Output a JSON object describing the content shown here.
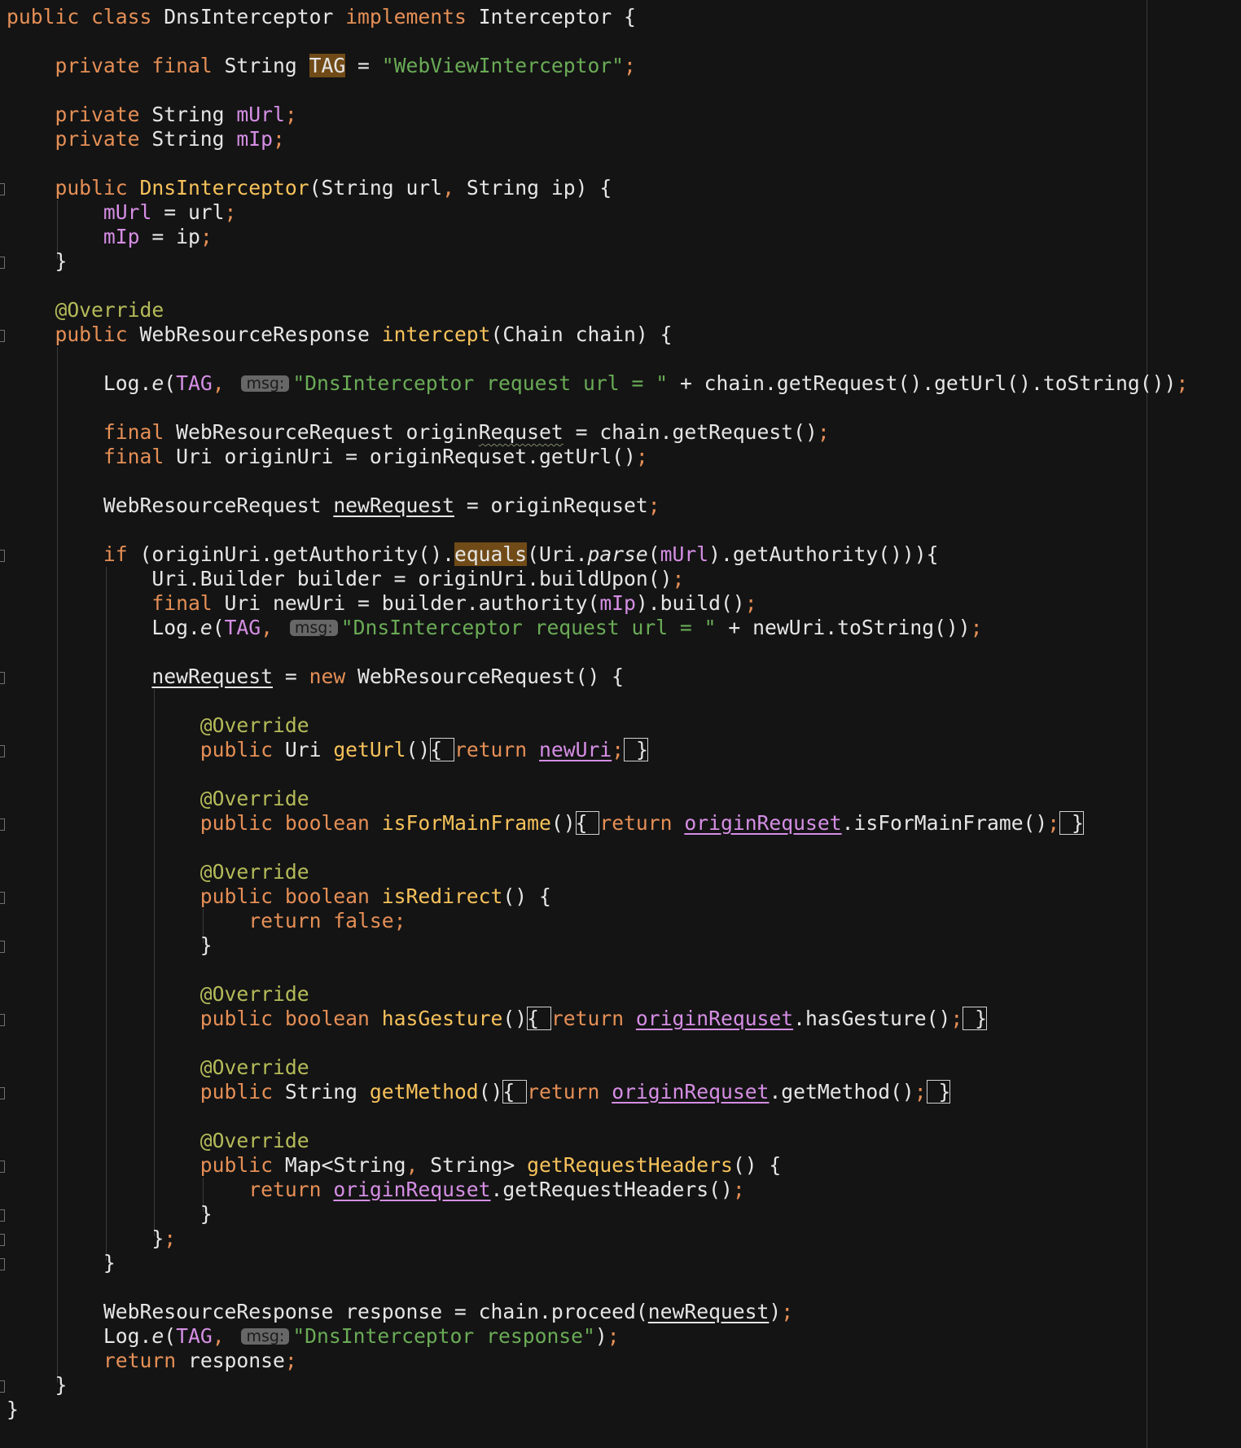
{
  "editor": {
    "language": "java",
    "theme": "dark",
    "colors": {
      "background": "#141414",
      "keyword": "#e58f56",
      "string": "#6aab56",
      "field": "#d58ee4",
      "method": "#f7c25b",
      "annotation": "#b5bb59",
      "plain": "#e6e6e6",
      "hint_background": "#676767",
      "search_highlight": "#704b17"
    },
    "lines": [
      [
        [
          "keyword",
          "public class "
        ],
        [
          "plain",
          "DnsInterceptor "
        ],
        [
          "keyword",
          "implements "
        ],
        [
          "plain",
          "Interceptor {"
        ]
      ],
      [],
      [
        [
          "keyword",
          "    private final "
        ],
        [
          "plain",
          "String "
        ],
        [
          "plain-hl",
          "TAG"
        ],
        [
          "plain",
          " = "
        ],
        [
          "string",
          "\"WebViewInterceptor\""
        ],
        [
          "punct",
          ";"
        ]
      ],
      [],
      [
        [
          "keyword",
          "    private "
        ],
        [
          "plain",
          "String "
        ],
        [
          "field",
          "mUrl"
        ],
        [
          "punct",
          ";"
        ]
      ],
      [
        [
          "keyword",
          "    private "
        ],
        [
          "plain",
          "String "
        ],
        [
          "field",
          "mIp"
        ],
        [
          "punct",
          ";"
        ]
      ],
      [],
      [
        [
          "keyword",
          "    public "
        ],
        [
          "method",
          "DnsInterceptor"
        ],
        [
          "plain",
          "(String url"
        ],
        [
          "punct",
          ", "
        ],
        [
          "plain",
          "String ip) {"
        ]
      ],
      [
        [
          "field",
          "        mUrl"
        ],
        [
          "plain",
          " = url"
        ],
        [
          "punct",
          ";"
        ]
      ],
      [
        [
          "field",
          "        mIp"
        ],
        [
          "plain",
          " = ip"
        ],
        [
          "punct",
          ";"
        ]
      ],
      [
        [
          "plain",
          "    }"
        ]
      ],
      [],
      [
        [
          "annotation",
          "    @Override"
        ]
      ],
      [
        [
          "keyword",
          "    public "
        ],
        [
          "plain",
          "WebResourceResponse "
        ],
        [
          "method",
          "intercept"
        ],
        [
          "plain",
          "(Chain chain) {"
        ]
      ],
      [],
      [
        [
          "plain",
          "        Log."
        ],
        [
          "static",
          "e"
        ],
        [
          "plain",
          "("
        ],
        [
          "field",
          "TAG"
        ],
        [
          "punct",
          ", "
        ],
        [
          "hint",
          "msg:"
        ],
        [
          "string",
          "\"DnsInterceptor request url = \""
        ],
        [
          "plain",
          " + chain.getRequest().getUrl().toString())"
        ],
        [
          "punct",
          ";"
        ]
      ],
      [],
      [
        [
          "keyword",
          "        final "
        ],
        [
          "plain",
          "WebResourceRequest origin"
        ],
        [
          "squiggle",
          "Requset"
        ],
        [
          "plain",
          " = chain.getRequest()"
        ],
        [
          "punct",
          ";"
        ]
      ],
      [
        [
          "keyword",
          "        final "
        ],
        [
          "plain",
          "Uri originUri = originRequset.getUrl()"
        ],
        [
          "punct",
          ";"
        ]
      ],
      [],
      [
        [
          "plain",
          "        WebResourceRequest "
        ],
        [
          "underlined",
          "newRequest"
        ],
        [
          "plain",
          " = originRequset"
        ],
        [
          "punct",
          ";"
        ]
      ],
      [],
      [
        [
          "keyword",
          "        if "
        ],
        [
          "plain",
          "(originUri.getAuthority()."
        ],
        [
          "plain-hl",
          "equals"
        ],
        [
          "plain",
          "(Uri."
        ],
        [
          "static",
          "parse"
        ],
        [
          "plain",
          "("
        ],
        [
          "field",
          "mUrl"
        ],
        [
          "plain",
          ").getAuthority())){"
        ]
      ],
      [
        [
          "plain",
          "            Uri.Builder builder = originUri.buildUpon()"
        ],
        [
          "punct",
          ";"
        ]
      ],
      [
        [
          "keyword",
          "            final "
        ],
        [
          "plain",
          "Uri newUri = builder.authority("
        ],
        [
          "field",
          "mIp"
        ],
        [
          "plain",
          ").build()"
        ],
        [
          "punct",
          ";"
        ]
      ],
      [
        [
          "plain",
          "            Log."
        ],
        [
          "static",
          "e"
        ],
        [
          "plain",
          "("
        ],
        [
          "field",
          "TAG"
        ],
        [
          "punct",
          ", "
        ],
        [
          "hint",
          "msg:"
        ],
        [
          "string",
          "\"DnsInterceptor request url = \""
        ],
        [
          "plain",
          " + newUri.toString())"
        ],
        [
          "punct",
          ";"
        ]
      ],
      [],
      [
        [
          "plain",
          "            "
        ],
        [
          "underlined",
          "newRequest"
        ],
        [
          "plain",
          " = "
        ],
        [
          "keyword",
          "new "
        ],
        [
          "plain",
          "WebResourceRequest() {"
        ]
      ],
      [],
      [
        [
          "annotation",
          "                @Override"
        ]
      ],
      [
        [
          "keyword",
          "                public "
        ],
        [
          "plain",
          "Uri "
        ],
        [
          "method",
          "getUrl"
        ],
        [
          "plain",
          "()"
        ],
        [
          "box-plain",
          "{ "
        ],
        [
          "keyword",
          "return "
        ],
        [
          "field-link",
          "newUri"
        ],
        [
          "punct",
          ";"
        ],
        [
          "box-plain",
          " }"
        ]
      ],
      [],
      [
        [
          "annotation",
          "                @Override"
        ]
      ],
      [
        [
          "keyword",
          "                public boolean "
        ],
        [
          "method",
          "isForMainFrame"
        ],
        [
          "plain",
          "()"
        ],
        [
          "box-plain",
          "{ "
        ],
        [
          "keyword",
          "return "
        ],
        [
          "field-link",
          "originRequset"
        ],
        [
          "plain",
          ".isForMainFrame()"
        ],
        [
          "punct",
          ";"
        ],
        [
          "box-plain",
          " }"
        ]
      ],
      [],
      [
        [
          "annotation",
          "                @Override"
        ]
      ],
      [
        [
          "keyword",
          "                public boolean "
        ],
        [
          "method",
          "isRedirect"
        ],
        [
          "plain",
          "() {"
        ]
      ],
      [
        [
          "keyword",
          "                    return false"
        ],
        [
          "punct",
          ";"
        ]
      ],
      [
        [
          "plain",
          "                }"
        ]
      ],
      [],
      [
        [
          "annotation",
          "                @Override"
        ]
      ],
      [
        [
          "keyword",
          "                public boolean "
        ],
        [
          "method",
          "hasGesture"
        ],
        [
          "plain",
          "()"
        ],
        [
          "box-plain",
          "{ "
        ],
        [
          "keyword",
          "return "
        ],
        [
          "field-link",
          "originRequset"
        ],
        [
          "plain",
          ".hasGesture()"
        ],
        [
          "punct",
          ";"
        ],
        [
          "box-plain",
          " }"
        ]
      ],
      [],
      [
        [
          "annotation",
          "                @Override"
        ]
      ],
      [
        [
          "keyword",
          "                public "
        ],
        [
          "plain",
          "String "
        ],
        [
          "method",
          "getMethod"
        ],
        [
          "plain",
          "()"
        ],
        [
          "box-plain",
          "{ "
        ],
        [
          "keyword",
          "return "
        ],
        [
          "field-link",
          "originRequset"
        ],
        [
          "plain",
          ".getMethod()"
        ],
        [
          "punct",
          ";"
        ],
        [
          "box-plain",
          " }"
        ]
      ],
      [],
      [
        [
          "annotation",
          "                @Override"
        ]
      ],
      [
        [
          "keyword",
          "                public "
        ],
        [
          "plain",
          "Map<String"
        ],
        [
          "punct",
          ", "
        ],
        [
          "plain",
          "String> "
        ],
        [
          "method",
          "getRequestHeaders"
        ],
        [
          "plain",
          "() {"
        ]
      ],
      [
        [
          "keyword",
          "                    return "
        ],
        [
          "field-link",
          "originRequset"
        ],
        [
          "plain",
          ".getRequestHeaders()"
        ],
        [
          "punct",
          ";"
        ]
      ],
      [
        [
          "plain",
          "                }"
        ]
      ],
      [
        [
          "plain",
          "            }"
        ],
        [
          "punct",
          ";"
        ]
      ],
      [
        [
          "plain",
          "        }"
        ]
      ],
      [],
      [
        [
          "plain",
          "        WebResourceResponse response = chain.proceed("
        ],
        [
          "underlined",
          "newRequest"
        ],
        [
          "plain",
          ")"
        ],
        [
          "punct",
          ";"
        ]
      ],
      [
        [
          "plain",
          "        Log."
        ],
        [
          "static",
          "e"
        ],
        [
          "plain",
          "("
        ],
        [
          "field",
          "TAG"
        ],
        [
          "punct",
          ", "
        ],
        [
          "hint",
          "msg:"
        ],
        [
          "string",
          "\"DnsInterceptor response\""
        ],
        [
          "plain",
          ")"
        ],
        [
          "punct",
          ";"
        ]
      ],
      [
        [
          "keyword",
          "        return "
        ],
        [
          "plain",
          "response"
        ],
        [
          "punct",
          ";"
        ]
      ],
      [
        [
          "plain",
          "    }"
        ]
      ],
      [
        [
          "plain",
          "}"
        ]
      ]
    ],
    "fold_markers": [
      7,
      10,
      13,
      22,
      27,
      30,
      33,
      36,
      38,
      41,
      44,
      47,
      49,
      50,
      51,
      56
    ]
  }
}
